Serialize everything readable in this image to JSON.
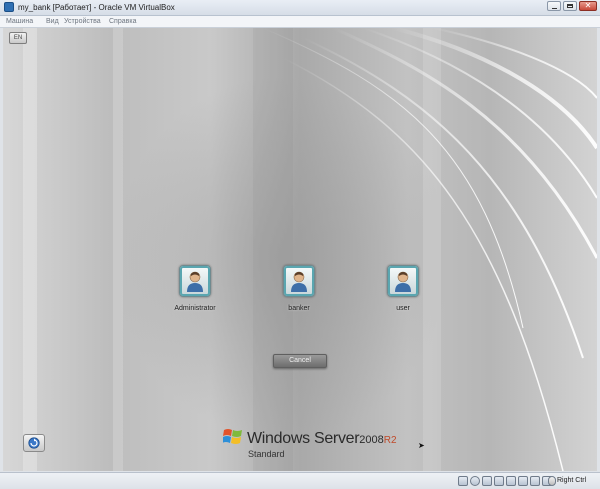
{
  "window": {
    "title": "my_bank [Работает] - Oracle VM VirtualBox",
    "controls": [
      "minimize",
      "maximize",
      "close"
    ]
  },
  "menu": {
    "items": [
      {
        "label": "Машина"
      },
      {
        "label": "Вид"
      },
      {
        "label": "Устройства"
      },
      {
        "label": "Справка"
      }
    ]
  },
  "login": {
    "keyboard_badge": "EN",
    "users": [
      {
        "name": "Administrator",
        "icon": "user-avatar-icon"
      },
      {
        "name": "banker",
        "icon": "user-avatar-icon"
      },
      {
        "name": "user",
        "icon": "user-avatar-icon"
      }
    ],
    "cancel_label": "Cancel",
    "brand": {
      "product": "Windows Server",
      "version": "2008",
      "release": "R2",
      "edition": "Standard"
    },
    "ease_of_access_icon": "ease-of-access-icon"
  },
  "statusbar": {
    "icons": [
      "hard-disk-icon",
      "optical-drive-icon",
      "usb-icon",
      "shared-folders-icon",
      "display-icon",
      "network-icon",
      "video-capture-icon",
      "cpu-icon",
      "mouse-integration-icon"
    ],
    "host_key": "Right Ctrl"
  }
}
